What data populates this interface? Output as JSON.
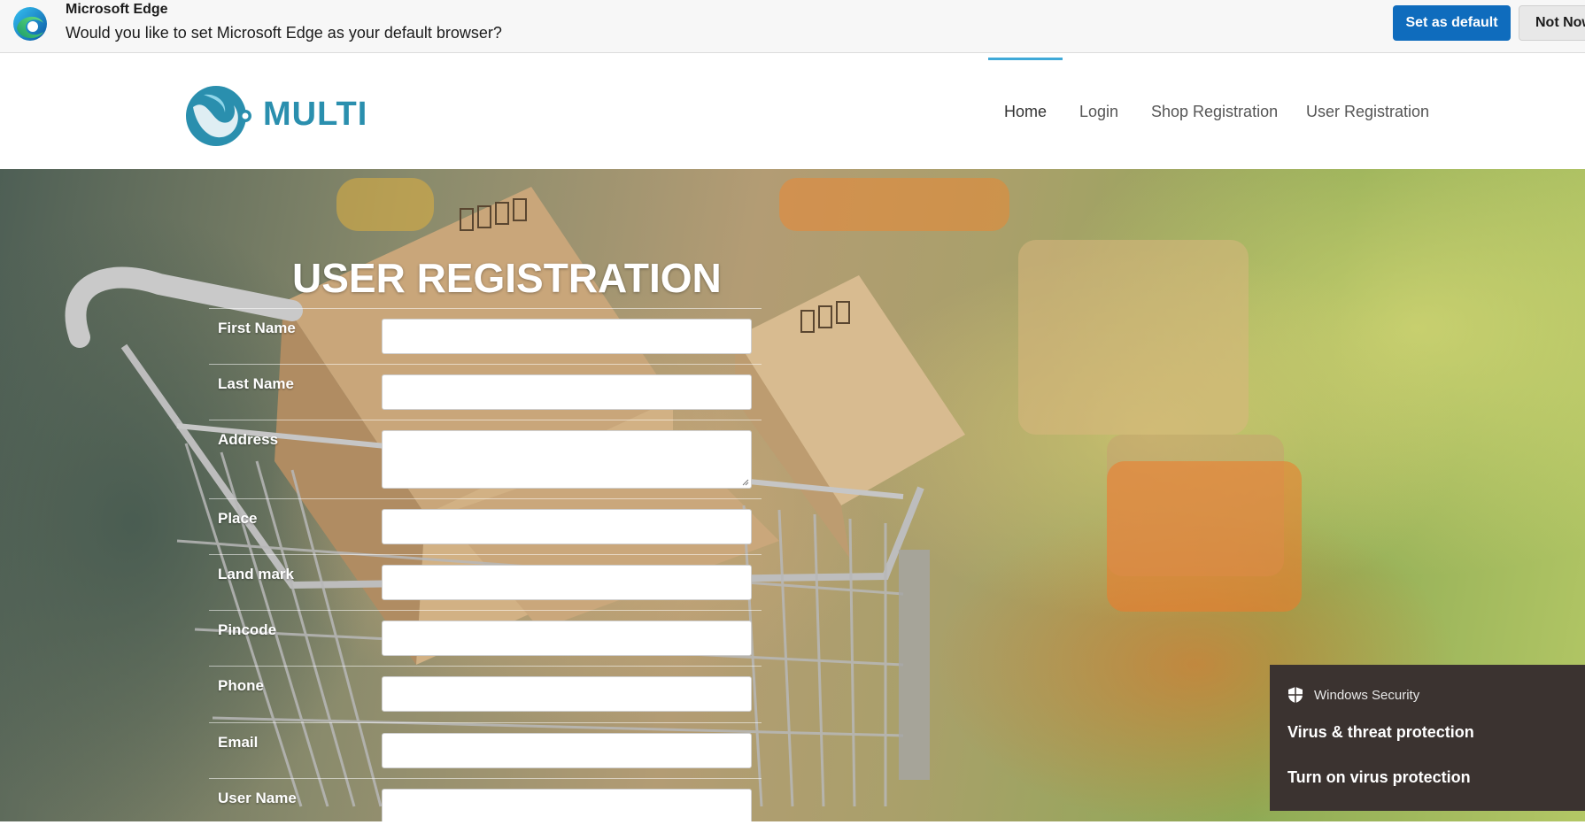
{
  "edge_prompt": {
    "title": "Microsoft Edge",
    "question": "Would you like to set Microsoft Edge as your default browser?",
    "set_default_label": "Set as default",
    "not_now_label": "Not Now",
    "accent_color": "#0f6cbd"
  },
  "site": {
    "brand": "MULTI",
    "brand_color": "#2a8fae",
    "nav": {
      "home": "Home",
      "login": "Login",
      "shop_registration": "Shop Registration",
      "user_registration": "User Registration",
      "active": "Home"
    }
  },
  "form": {
    "title": "USER REGISTRATION",
    "fields": {
      "first_name": {
        "label": "First Name",
        "value": ""
      },
      "last_name": {
        "label": "Last Name",
        "value": ""
      },
      "address": {
        "label": "Address",
        "value": ""
      },
      "place": {
        "label": "Place",
        "value": ""
      },
      "landmark": {
        "label": "Land mark",
        "value": ""
      },
      "pincode": {
        "label": "Pincode",
        "value": ""
      },
      "phone": {
        "label": "Phone",
        "value": ""
      },
      "email": {
        "label": "Email",
        "value": ""
      },
      "username": {
        "label": "User Name",
        "value": ""
      }
    }
  },
  "toast": {
    "app_name": "Windows Security",
    "title": "Virus & threat protection",
    "body": "Turn on virus protection",
    "icon": "shield-icon"
  }
}
